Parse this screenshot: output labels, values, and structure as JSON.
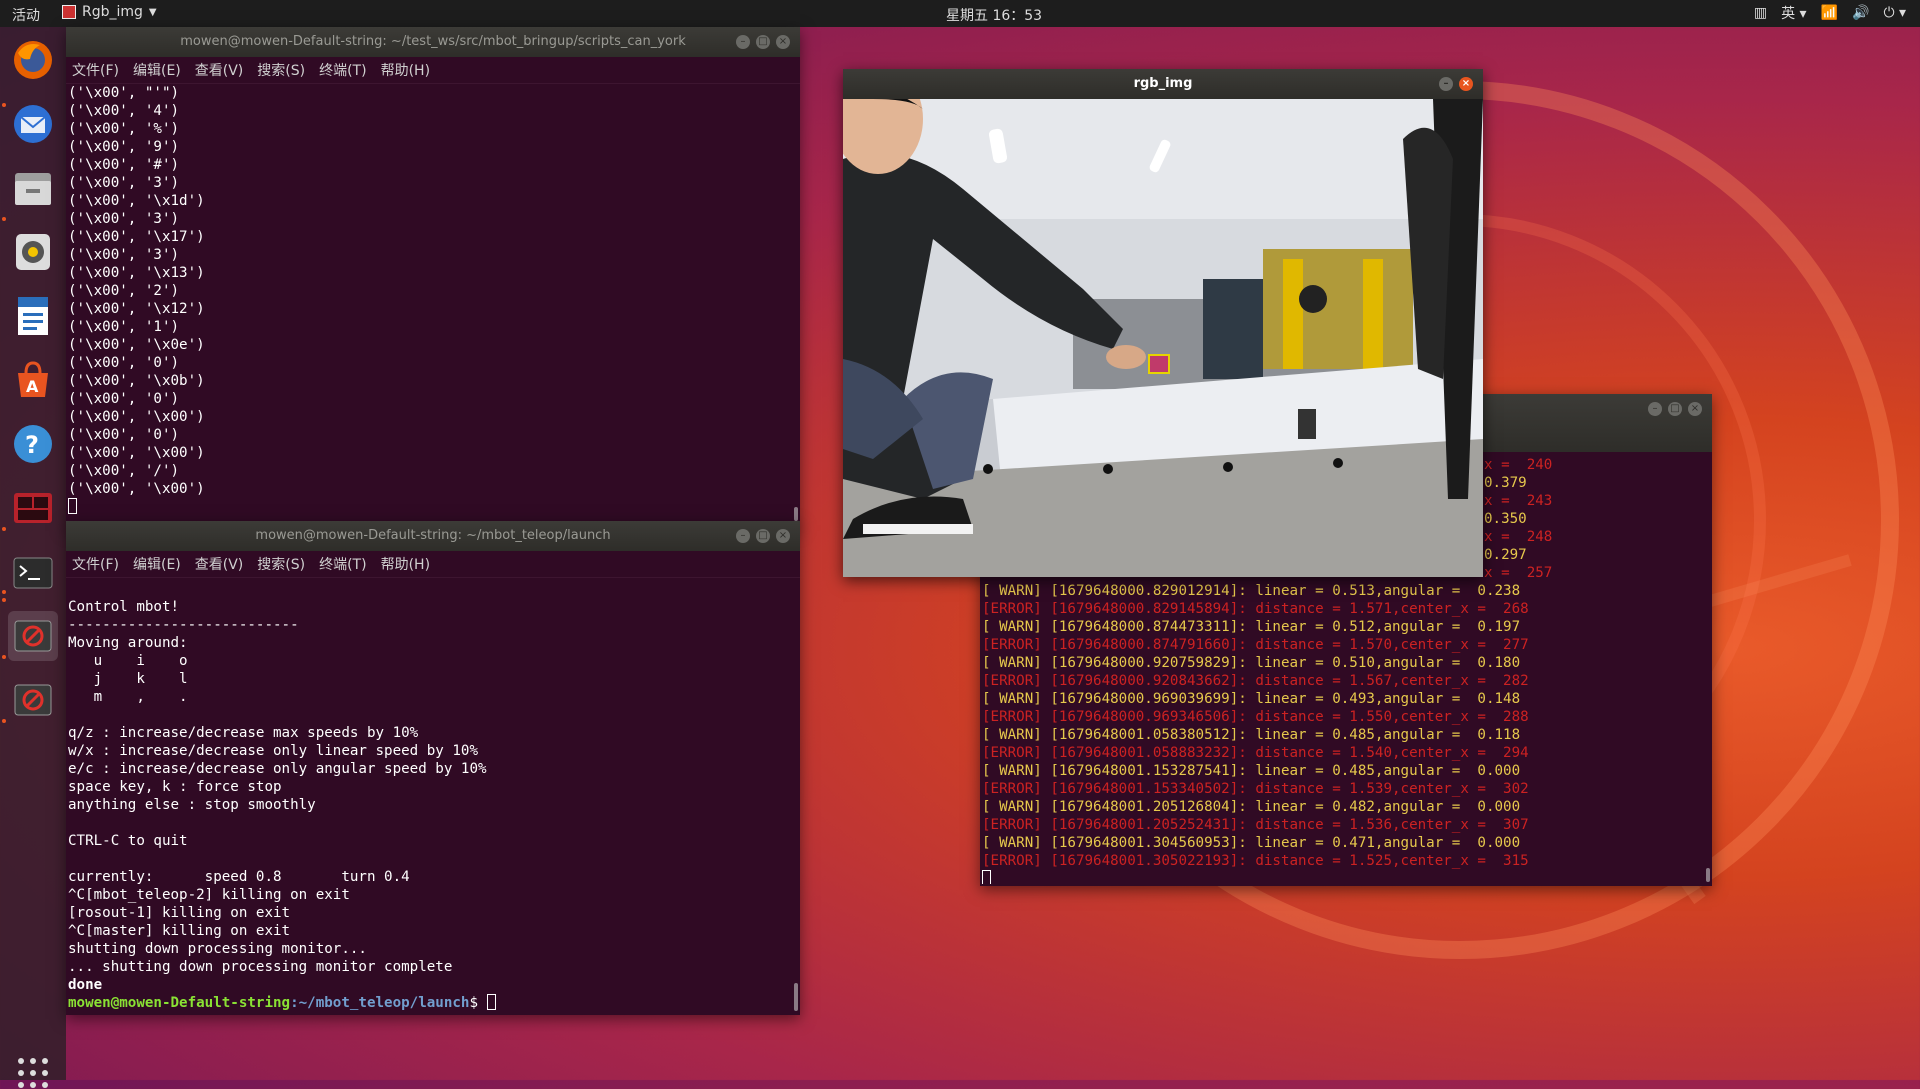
{
  "topbar": {
    "activities": "活动",
    "app_name": "Rgb_img",
    "clock": "星期五 16：53",
    "input_method": "英"
  },
  "dock": {
    "icons": [
      "firefox-icon",
      "thunderbird-icon",
      "files-icon",
      "rhythmbox-icon",
      "writer-icon",
      "software-center-icon",
      "help-icon",
      "terminal-multi-icon",
      "terminal-icon",
      "blocked-app-icon",
      "blocked-app-icon-2",
      "show-apps-icon"
    ]
  },
  "menus": [
    "文件(F)",
    "编辑(E)",
    "查看(V)",
    "搜索(S)",
    "终端(T)",
    "帮助(H)"
  ],
  "terminal1": {
    "title": "mowen@mowen-Default-string: ~/test_ws/src/mbot_bringup/scripts_can_york",
    "lines": [
      "('\\x00', \"'\")",
      "('\\x00', '4')",
      "('\\x00', '%')",
      "('\\x00', '9')",
      "('\\x00', '#')",
      "('\\x00', '3')",
      "('\\x00', '\\x1d')",
      "('\\x00', '3')",
      "('\\x00', '\\x17')",
      "('\\x00', '3')",
      "('\\x00', '\\x13')",
      "('\\x00', '2')",
      "('\\x00', '\\x12')",
      "('\\x00', '1')",
      "('\\x00', '\\x0e')",
      "('\\x00', '0')",
      "('\\x00', '\\x0b')",
      "('\\x00', '0')",
      "('\\x00', '\\x00')",
      "('\\x00', '0')",
      "('\\x00', '\\x00')",
      "('\\x00', '/')",
      "('\\x00', '\\x00')"
    ]
  },
  "terminal2": {
    "title": "mowen@mowen-Default-string: ~/mbot_teleop/launch",
    "lines": [
      "",
      "Control mbot!",
      "---------------------------",
      "Moving around:",
      "   u    i    o",
      "   j    k    l",
      "   m    ,    .",
      "",
      "q/z : increase/decrease max speeds by 10%",
      "w/x : increase/decrease only linear speed by 10%",
      "e/c : increase/decrease only angular speed by 10%",
      "space key, k : force stop",
      "anything else : stop smoothly",
      "",
      "CTRL-C to quit",
      "",
      "currently:      speed 0.8       turn 0.4",
      "^C[mbot_teleop-2] killing on exit",
      "[rosout-1] killing on exit",
      "^C[master] killing on exit",
      "shutting down processing monitor...",
      "... shutting down processing monitor complete"
    ],
    "done": "done",
    "prompt_user": "mowen@mowen-Default-string",
    "prompt_path": ":~/mbot_teleop/launch",
    "prompt_end": "$ "
  },
  "terminal3": {
    "hidden_lines": [
      {
        "type": "err",
        "text": "x =  240"
      },
      {
        "type": "warn",
        "text": "0.379"
      },
      {
        "type": "err",
        "text": "x =  243"
      },
      {
        "type": "warn",
        "text": "0.350"
      },
      {
        "type": "err",
        "text": "x =  248"
      },
      {
        "type": "warn",
        "text": "0.297"
      },
      {
        "type": "err",
        "text": "x =  257"
      }
    ],
    "lines": [
      {
        "type": "warn",
        "text": "[ WARN] [1679648000.829012914]: linear = 0.513,angular =  0.238"
      },
      {
        "type": "err",
        "text": "[ERROR] [1679648000.829145894]: distance = 1.571,center_x =  268"
      },
      {
        "type": "warn",
        "text": "[ WARN] [1679648000.874473311]: linear = 0.512,angular =  0.197"
      },
      {
        "type": "err",
        "text": "[ERROR] [1679648000.874791660]: distance = 1.570,center_x =  277"
      },
      {
        "type": "warn",
        "text": "[ WARN] [1679648000.920759829]: linear = 0.510,angular =  0.180"
      },
      {
        "type": "err",
        "text": "[ERROR] [1679648000.920843662]: distance = 1.567,center_x =  282"
      },
      {
        "type": "warn",
        "text": "[ WARN] [1679648000.969039699]: linear = 0.493,angular =  0.148"
      },
      {
        "type": "err",
        "text": "[ERROR] [1679648000.969346506]: distance = 1.550,center_x =  288"
      },
      {
        "type": "warn",
        "text": "[ WARN] [1679648001.058380512]: linear = 0.485,angular =  0.118"
      },
      {
        "type": "err",
        "text": "[ERROR] [1679648001.058883232]: distance = 1.540,center_x =  294"
      },
      {
        "type": "warn",
        "text": "[ WARN] [1679648001.153287541]: linear = 0.485,angular =  0.000"
      },
      {
        "type": "err",
        "text": "[ERROR] [1679648001.153340502]: distance = 1.539,center_x =  302"
      },
      {
        "type": "warn",
        "text": "[ WARN] [1679648001.205126804]: linear = 0.482,angular =  0.000"
      },
      {
        "type": "err",
        "text": "[ERROR] [1679648001.205252431]: distance = 1.536,center_x =  307"
      },
      {
        "type": "warn",
        "text": "[ WARN] [1679648001.304560953]: linear = 0.471,angular =  0.000"
      },
      {
        "type": "err",
        "text": "[ERROR] [1679648001.305022193]: distance = 1.525,center_x =  315"
      }
    ]
  },
  "image_window": {
    "title": "rgb_img"
  },
  "colors": {
    "terminal_bg": "#300a24",
    "warn": "#e6c84c",
    "error": "#cc2222",
    "ubuntu_orange": "#e95420"
  }
}
